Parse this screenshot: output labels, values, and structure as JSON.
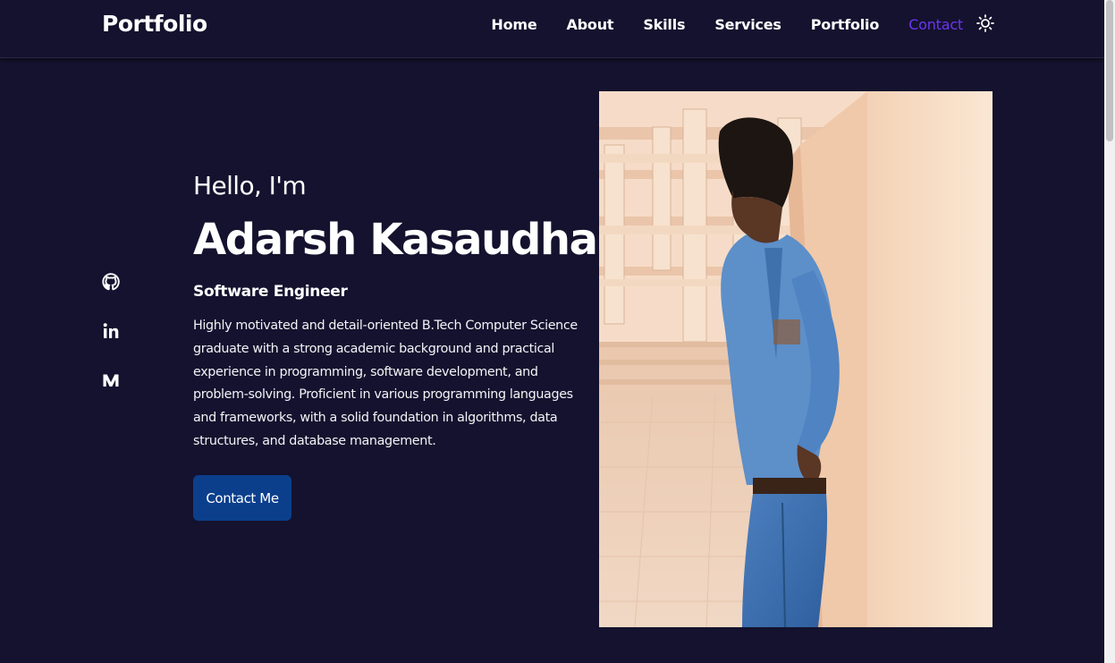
{
  "header": {
    "logo": "Portfolio",
    "nav": [
      {
        "label": "Home"
      },
      {
        "label": "About"
      },
      {
        "label": "Skills"
      },
      {
        "label": "Services"
      },
      {
        "label": "Portfolio"
      },
      {
        "label": "Contact",
        "active": true
      }
    ],
    "theme_toggle_icon": "sun-icon",
    "active_color": "#6c35f0"
  },
  "socials": [
    {
      "icon": "github-icon"
    },
    {
      "icon": "linkedin-icon"
    },
    {
      "icon": "medium-icon"
    }
  ],
  "hero": {
    "greeting": "Hello, I'm",
    "name": "Adarsh Kasaudhan",
    "role": "Software Engineer",
    "bio": "Highly motivated and detail-oriented B.Tech Computer Science graduate with a strong academic background and practical experience in programming, software development, and problem-solving. Proficient in various programming languages and frameworks, with a solid foundation in algorithms, data structures, and database management.",
    "cta_label": "Contact Me",
    "cta_color": "#0b3f8c"
  },
  "colors": {
    "background": "#14122e",
    "text": "#ffffff"
  }
}
